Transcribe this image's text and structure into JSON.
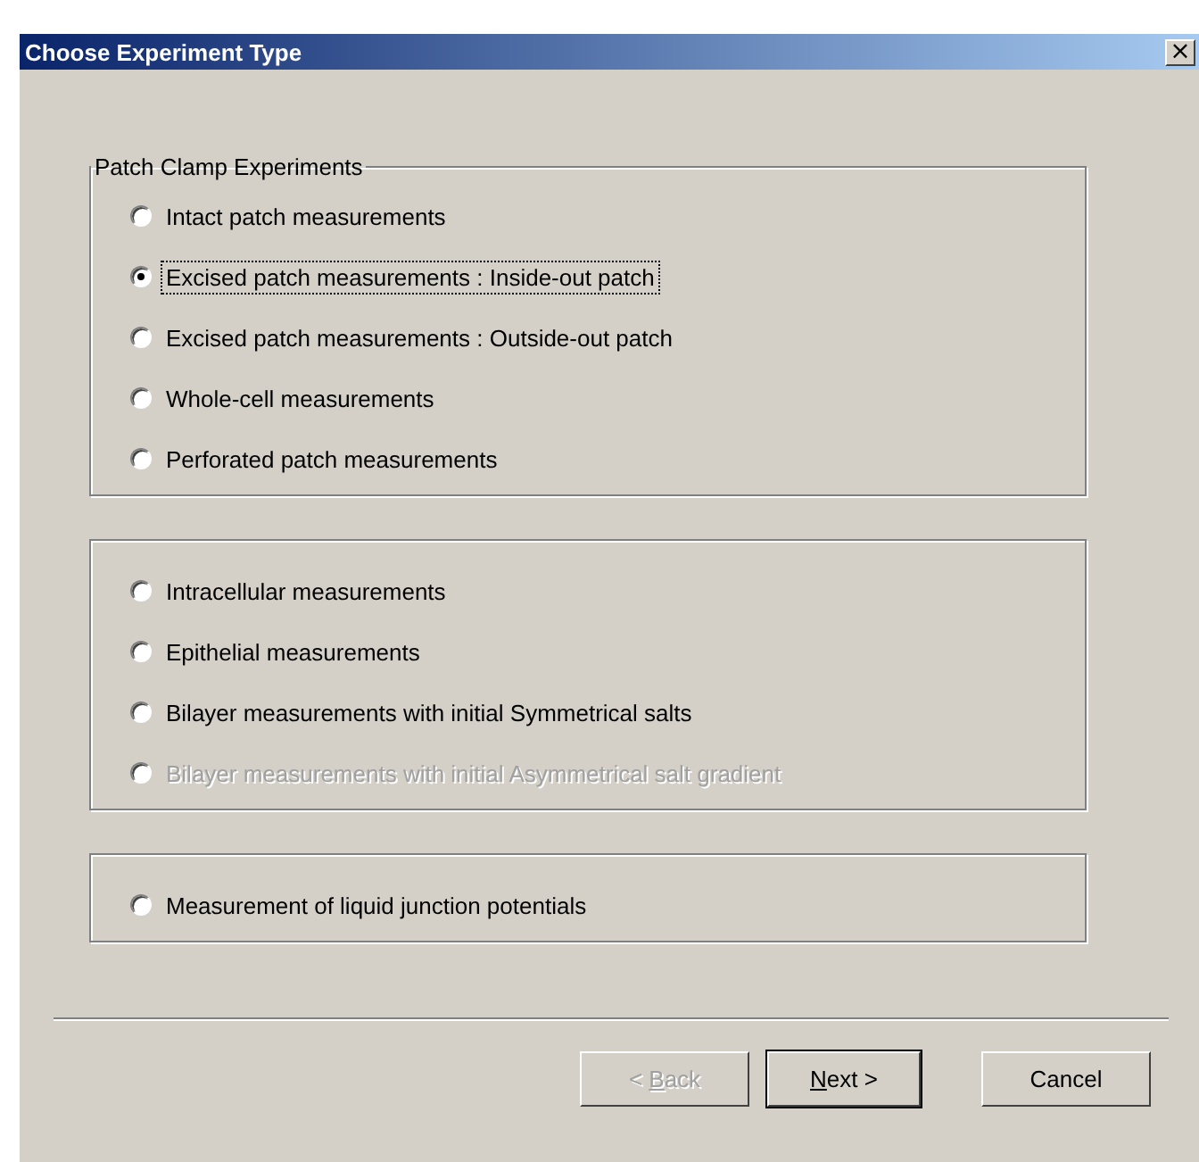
{
  "window": {
    "title": "Choose Experiment Type",
    "close": "×"
  },
  "groups": [
    {
      "title": "Patch Clamp Experiments",
      "options": [
        {
          "label": "Intact patch measurements",
          "selected": false,
          "disabled": false,
          "focused": false
        },
        {
          "label": "Excised patch measurements : Inside-out patch",
          "selected": true,
          "disabled": false,
          "focused": true
        },
        {
          "label": "Excised patch measurements : Outside-out patch",
          "selected": false,
          "disabled": false,
          "focused": false
        },
        {
          "label": "Whole-cell measurements",
          "selected": false,
          "disabled": false,
          "focused": false
        },
        {
          "label": "Perforated patch measurements",
          "selected": false,
          "disabled": false,
          "focused": false
        }
      ]
    },
    {
      "options": [
        {
          "label": "Intracellular measurements",
          "selected": false,
          "disabled": false,
          "focused": false
        },
        {
          "label": "Epithelial measurements",
          "selected": false,
          "disabled": false,
          "focused": false
        },
        {
          "label": "Bilayer measurements with initial Symmetrical salts",
          "selected": false,
          "disabled": false,
          "focused": false
        },
        {
          "label": "Bilayer measurements with initial Asymmetrical salt gradient",
          "selected": false,
          "disabled": true,
          "focused": false
        }
      ]
    },
    {
      "options": [
        {
          "label": "Measurement of liquid junction potentials",
          "selected": false,
          "disabled": false,
          "focused": false
        }
      ]
    }
  ],
  "buttons": [
    {
      "parts": [
        {
          "text": "< ",
          "underlined": false
        },
        {
          "text": "B",
          "underlined": true
        },
        {
          "text": "ack",
          "underlined": false
        }
      ],
      "disabled": true,
      "default": false
    },
    {
      "parts": [
        {
          "text": "N",
          "underlined": true
        },
        {
          "text": "ext >",
          "underlined": false
        }
      ],
      "disabled": false,
      "default": true
    },
    {
      "parts": [
        {
          "text": "Cancel",
          "underlined": false
        }
      ],
      "disabled": false,
      "default": false
    }
  ]
}
